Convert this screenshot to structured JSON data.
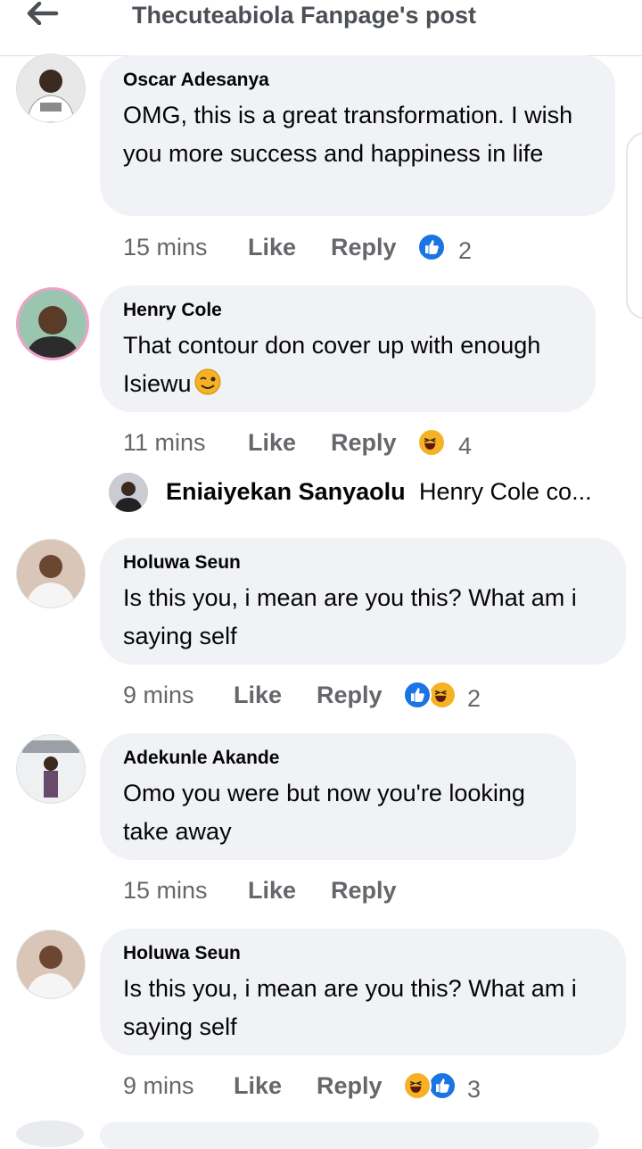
{
  "header": {
    "title": "Thecuteabiola Fanpage's post",
    "back_icon": "arrow-left-icon"
  },
  "labels": {
    "like": "Like",
    "reply": "Reply"
  },
  "comments": [
    {
      "author": "Oscar Adesanya",
      "text": "OMG, this is a great transformation. I wish you more success and happiness in life",
      "time": "15 mins",
      "reactions": [
        "like"
      ],
      "count": "2"
    },
    {
      "author": "Henry Cole",
      "text": "That contour don cover up with enough Isiewu",
      "emoji": "wink-face-emoji",
      "time": "11 mins",
      "reactions": [
        "haha"
      ],
      "count": "4"
    },
    {
      "author": "Holuwa Seun",
      "text": "Is this you, i mean are you this? What am i saying self",
      "time": "9 mins",
      "reactions": [
        "like",
        "haha"
      ],
      "count": "2"
    },
    {
      "author": "Adekunle Akande",
      "text": "Omo you were but now you're looking take away",
      "time": "15 mins",
      "reactions": [],
      "count": ""
    },
    {
      "author": "Holuwa Seun",
      "text": "Is this you, i mean are you this? What am i saying self",
      "time": "9 mins",
      "reactions": [
        "haha",
        "like"
      ],
      "count": "3"
    }
  ],
  "reply_preview": {
    "author": "Eniaiyekan Sanyaolu",
    "text": "Henry Cole co..."
  },
  "colors": {
    "like_blue": "#1b74e4",
    "haha_yellow": "#f7b125",
    "bubble": "#f0f2f5",
    "meta": "#65676b"
  }
}
